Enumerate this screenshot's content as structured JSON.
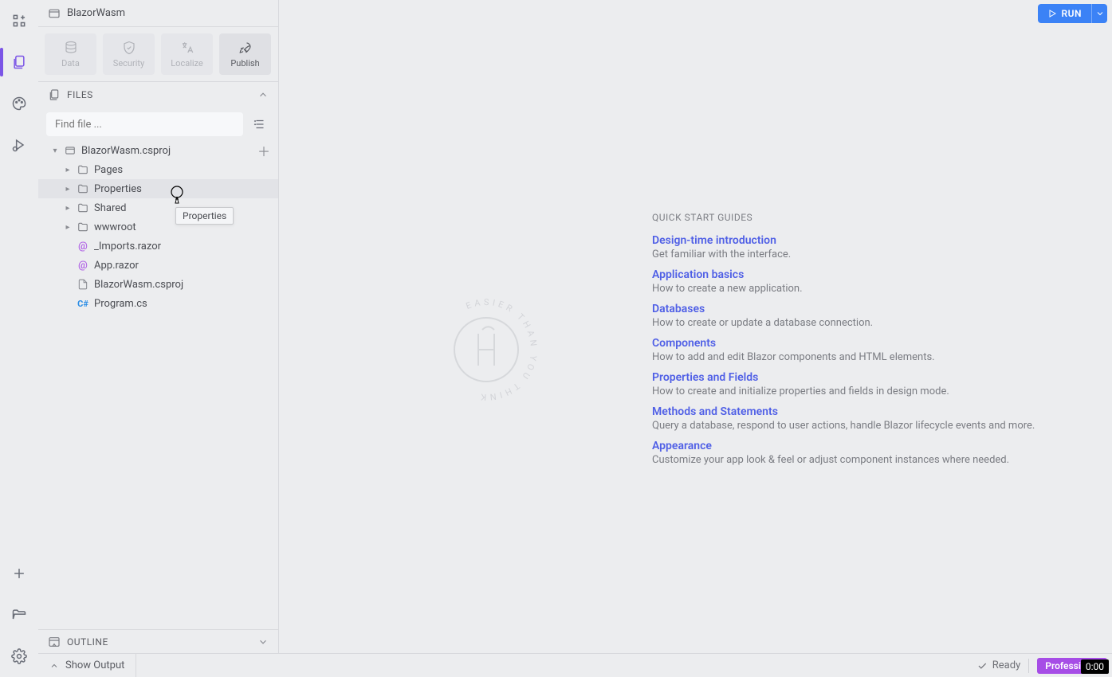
{
  "project": {
    "name": "BlazorWasm"
  },
  "toolbar": {
    "data": "Data",
    "security": "Security",
    "localize": "Localize",
    "publish": "Publish"
  },
  "files_panel": {
    "title": "FILES",
    "find_placeholder": "Find file ...",
    "tree": {
      "root": "BlazorWasm.csproj",
      "folders": [
        {
          "name": "Pages"
        },
        {
          "name": "Properties"
        },
        {
          "name": "Shared"
        },
        {
          "name": "wwwroot"
        }
      ],
      "files": [
        {
          "name": "_Imports.razor",
          "icon": "at"
        },
        {
          "name": "App.razor",
          "icon": "at"
        },
        {
          "name": "BlazorWasm.csproj",
          "icon": "doc"
        },
        {
          "name": "Program.cs",
          "icon": "cs"
        }
      ]
    }
  },
  "tooltip": "Properties",
  "outline_panel": {
    "title": "OUTLINE"
  },
  "run_button": "RUN",
  "quickstart": {
    "title": "QUICK START GUIDES",
    "items": [
      {
        "link": "Design-time introduction",
        "desc": "Get familiar with the interface."
      },
      {
        "link": "Application basics",
        "desc": "How to create a new application."
      },
      {
        "link": "Databases",
        "desc": "How to create or update a database connection."
      },
      {
        "link": "Components",
        "desc": "How to add and edit Blazor components and HTML elements."
      },
      {
        "link": "Properties and Fields",
        "desc": "How to create and initialize properties and fields in design mode."
      },
      {
        "link": "Methods and Statements",
        "desc": "Query a database, respond to user actions, handle Blazor lifecycle events and more."
      },
      {
        "link": "Appearance",
        "desc": "Customize your app look & feel or adjust component instances where needed."
      }
    ]
  },
  "watermark_text": "EASIER THAN YOU THINK",
  "bottom": {
    "show_output": "Show Output",
    "ready": "Ready",
    "plan": "Professional"
  },
  "time_indicator": "0:00"
}
